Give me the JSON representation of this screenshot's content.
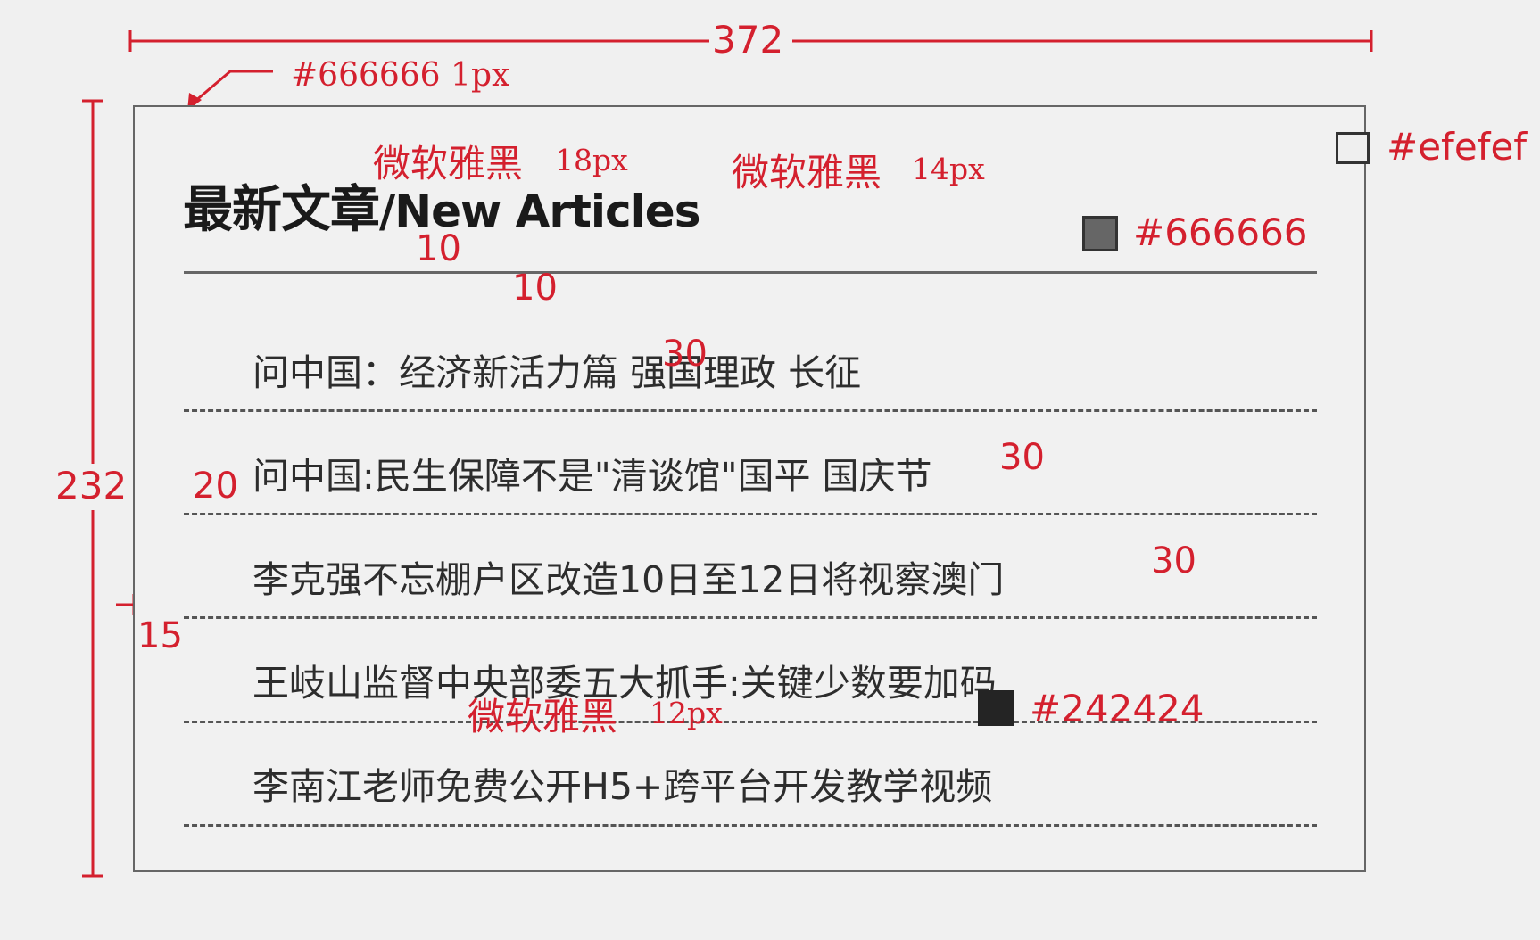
{
  "panel": {
    "title": "最新文章",
    "title_sub": "/New Articles",
    "items": [
      "问中国：经济新活力篇 强国理政 长征",
      "问中国:民生保障不是\"清谈馆\"国平 国庆节",
      "李克强不忘棚户区改造10日至12日将视察澳门",
      "王岐山监督中央部委五大抓手:关键少数要加码",
      "李南江老师免费公开H5+跨平台开发教学视频"
    ]
  },
  "annotations": {
    "width": "372",
    "height": "232",
    "border": "#666666 1px",
    "title_font_cn": "微软雅黑",
    "title_size_cn": "18px",
    "title_font_en": "微软雅黑",
    "title_size_en": "14px",
    "bg_color": "#efefef",
    "rule_color": "#666666",
    "gap_title_rule": "10",
    "gap_rule_list": "10",
    "row_height_1": "30",
    "row_height_2": "30",
    "row_height_3": "30",
    "indent": "20",
    "margin": "15",
    "item_font": "微软雅黑",
    "item_size": "12px",
    "item_color": "#242424"
  },
  "colors": {
    "annotation": "#d4202e",
    "border": "#666666",
    "background": "#efefef",
    "text": "#242424"
  }
}
